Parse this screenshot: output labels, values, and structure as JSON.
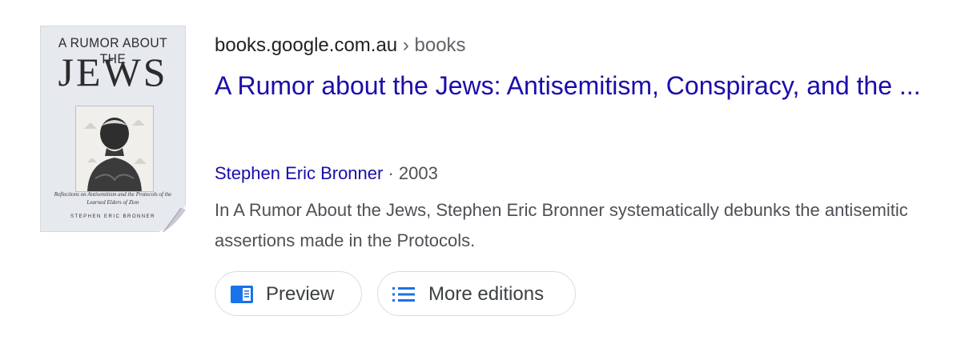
{
  "result": {
    "source": {
      "domain": "books.google.com.au",
      "separator": "›",
      "path": "books"
    },
    "title": "A Rumor about the Jews: Antisemitism, Conspiracy, and the ...",
    "author": "Stephen Eric Bronner",
    "meta_separator": " · ",
    "year": "2003",
    "snippet": "In A Rumor About the Jews, Stephen Eric Bronner systematically debunks the antisemitic assertions made in the Protocols.",
    "cover": {
      "top_line": "A RUMOR ABOUT THE",
      "big_word": "JEWS",
      "subtitle": "Reflections on Antisemitism and the Protocols of the Learned Elders of Zion",
      "author": "STEPHEN ERIC BRONNER"
    },
    "actions": [
      {
        "label": "Preview",
        "icon": "book-preview-icon"
      },
      {
        "label": "More editions",
        "icon": "list-icon"
      }
    ]
  },
  "colors": {
    "link": "#1a0dab",
    "text": "#4d5156",
    "icon_blue": "#1a73e8",
    "chip_border": "#dadce0"
  }
}
